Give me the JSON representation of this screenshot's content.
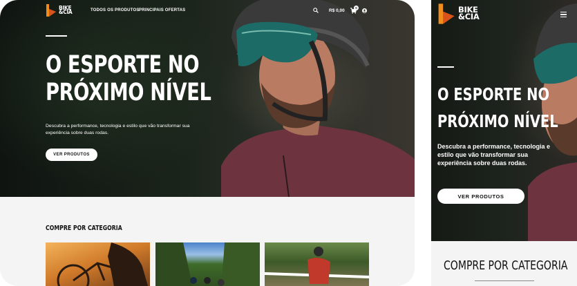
{
  "brand": {
    "name": "BIKE &CIA",
    "line1": "BIKE",
    "line2": "&CIA",
    "accent": "#f28c1b",
    "accent_dark": "#d9531a"
  },
  "nav": {
    "items": [
      {
        "label": "TODOS OS PRODUTOS"
      },
      {
        "label": "PRINCIPAIS OFERTAS"
      }
    ],
    "cart_total": "R$ 0,00",
    "cart_count": "0",
    "icons": [
      "search-icon",
      "cart-icon",
      "user-icon"
    ]
  },
  "hero": {
    "title_line1": "O ESPORTE NO",
    "title_line2": "PRÓXIMO NÍVEL",
    "subtitle": "Descubra a performance, tecnologia e estilo que vão transformar sua experiência sobre duas rodas.",
    "cta_label": "VER PRODUTOS"
  },
  "categories": {
    "title": "COMPRE POR CATEGORIA"
  },
  "mobile": {
    "menu_icon": "hamburger-icon"
  }
}
